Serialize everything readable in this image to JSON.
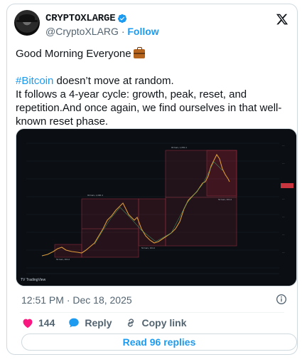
{
  "author": {
    "display_name": "CRYPTOXLARGE",
    "handle": "@CryptoXLARG",
    "separator": "·",
    "follow_label": "Follow",
    "verified": true
  },
  "tweet": {
    "greeting": "Good Morning Everyone",
    "hashtag": "#Bitcoin",
    "line1_rest": " doesn’t move at random.",
    "body": "It follows a 4-year cycle: growth, peak, reset, and repetition.And once again, we find ourselves in that well-known reset phase."
  },
  "media": {
    "watermark": "TV TradingView",
    "boxes": [
      "93 bars, 1,096 d",
      "93 bars, 1,053 d"
    ],
    "bottom_labels": [
      "52 bars, 364 d",
      "52 bars, 364 d",
      "52 bars, 364 d"
    ]
  },
  "meta": {
    "timestamp": "12:51 PM · Dec 18, 2025"
  },
  "actions": {
    "likes": "144",
    "reply_label": "Reply",
    "copy_link_label": "Copy link",
    "read_replies_label": "Read 96 replies"
  },
  "colors": {
    "link_blue": "#1d9bf0",
    "like_red": "#f91880",
    "secondary_text": "#536471"
  }
}
